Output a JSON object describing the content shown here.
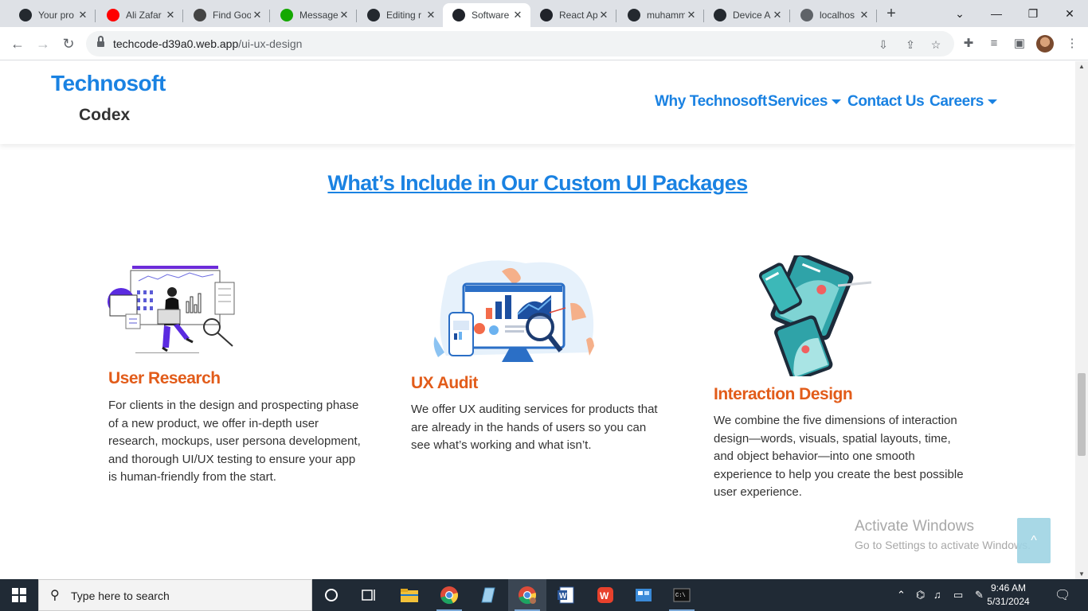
{
  "browser": {
    "tabs": [
      {
        "title": "Your pro",
        "icon": "github-icon",
        "color": "#24292f"
      },
      {
        "title": "Ali Zafar",
        "icon": "youtube-icon",
        "color": "#ff0000"
      },
      {
        "title": "Find Goo",
        "icon": "chatgpt-icon",
        "color": "#444444"
      },
      {
        "title": "Message",
        "icon": "upwork-icon",
        "color": "#14a800"
      },
      {
        "title": "Editing r",
        "icon": "github-icon",
        "color": "#24292f"
      },
      {
        "title": "Software",
        "icon": "react-icon",
        "color": "#20232a"
      },
      {
        "title": "React Ap",
        "icon": "react-icon",
        "color": "#20232a"
      },
      {
        "title": "muhamm",
        "icon": "github-icon",
        "color": "#24292f"
      },
      {
        "title": "Device A",
        "icon": "github-icon",
        "color": "#24292f"
      },
      {
        "title": "localhos",
        "icon": "globe-icon",
        "color": "#5f6368"
      }
    ],
    "active_tab_index": 5,
    "close_glyph": "✕",
    "new_tab_glyph": "+",
    "url_host": "techcode-d39a0.web.app",
    "url_path": "/ui-ux-design"
  },
  "site": {
    "logo_line1": "Technosoft",
    "logo_line2": "Codex",
    "nav": {
      "why": "Why Technosoft",
      "services": "Services",
      "contact": "Contact Us",
      "careers": "Careers"
    },
    "section_title": "What’s Include in Our Custom UI Packages",
    "cards": [
      {
        "title": "User Research",
        "text": "For clients in the design and prospecting phase of a new product, we offer in-depth user research, mockups, user persona development, and thorough UI/UX testing to ensure your app is human-friendly from the start."
      },
      {
        "title": "UX Audit",
        "text": "We offer UX auditing services for products that are already in the hands of users so you can see what’s working and what isn’t."
      },
      {
        "title": "Interaction Design",
        "text": "We combine the five dimensions of interaction design—words, visuals, spatial layouts, time, and object behavior—into one smooth experience to help you create the best possible user experience."
      }
    ],
    "back_to_top": "^",
    "colors": {
      "brand_blue": "#1a82e2",
      "accent_orange": "#e25c1a"
    }
  },
  "windows": {
    "watermark_title": "Activate Windows",
    "watermark_sub": "Go to Settings to activate Windows.",
    "search_placeholder": "Type here to search",
    "time": "9:46 AM",
    "date": "5/31/2024"
  }
}
